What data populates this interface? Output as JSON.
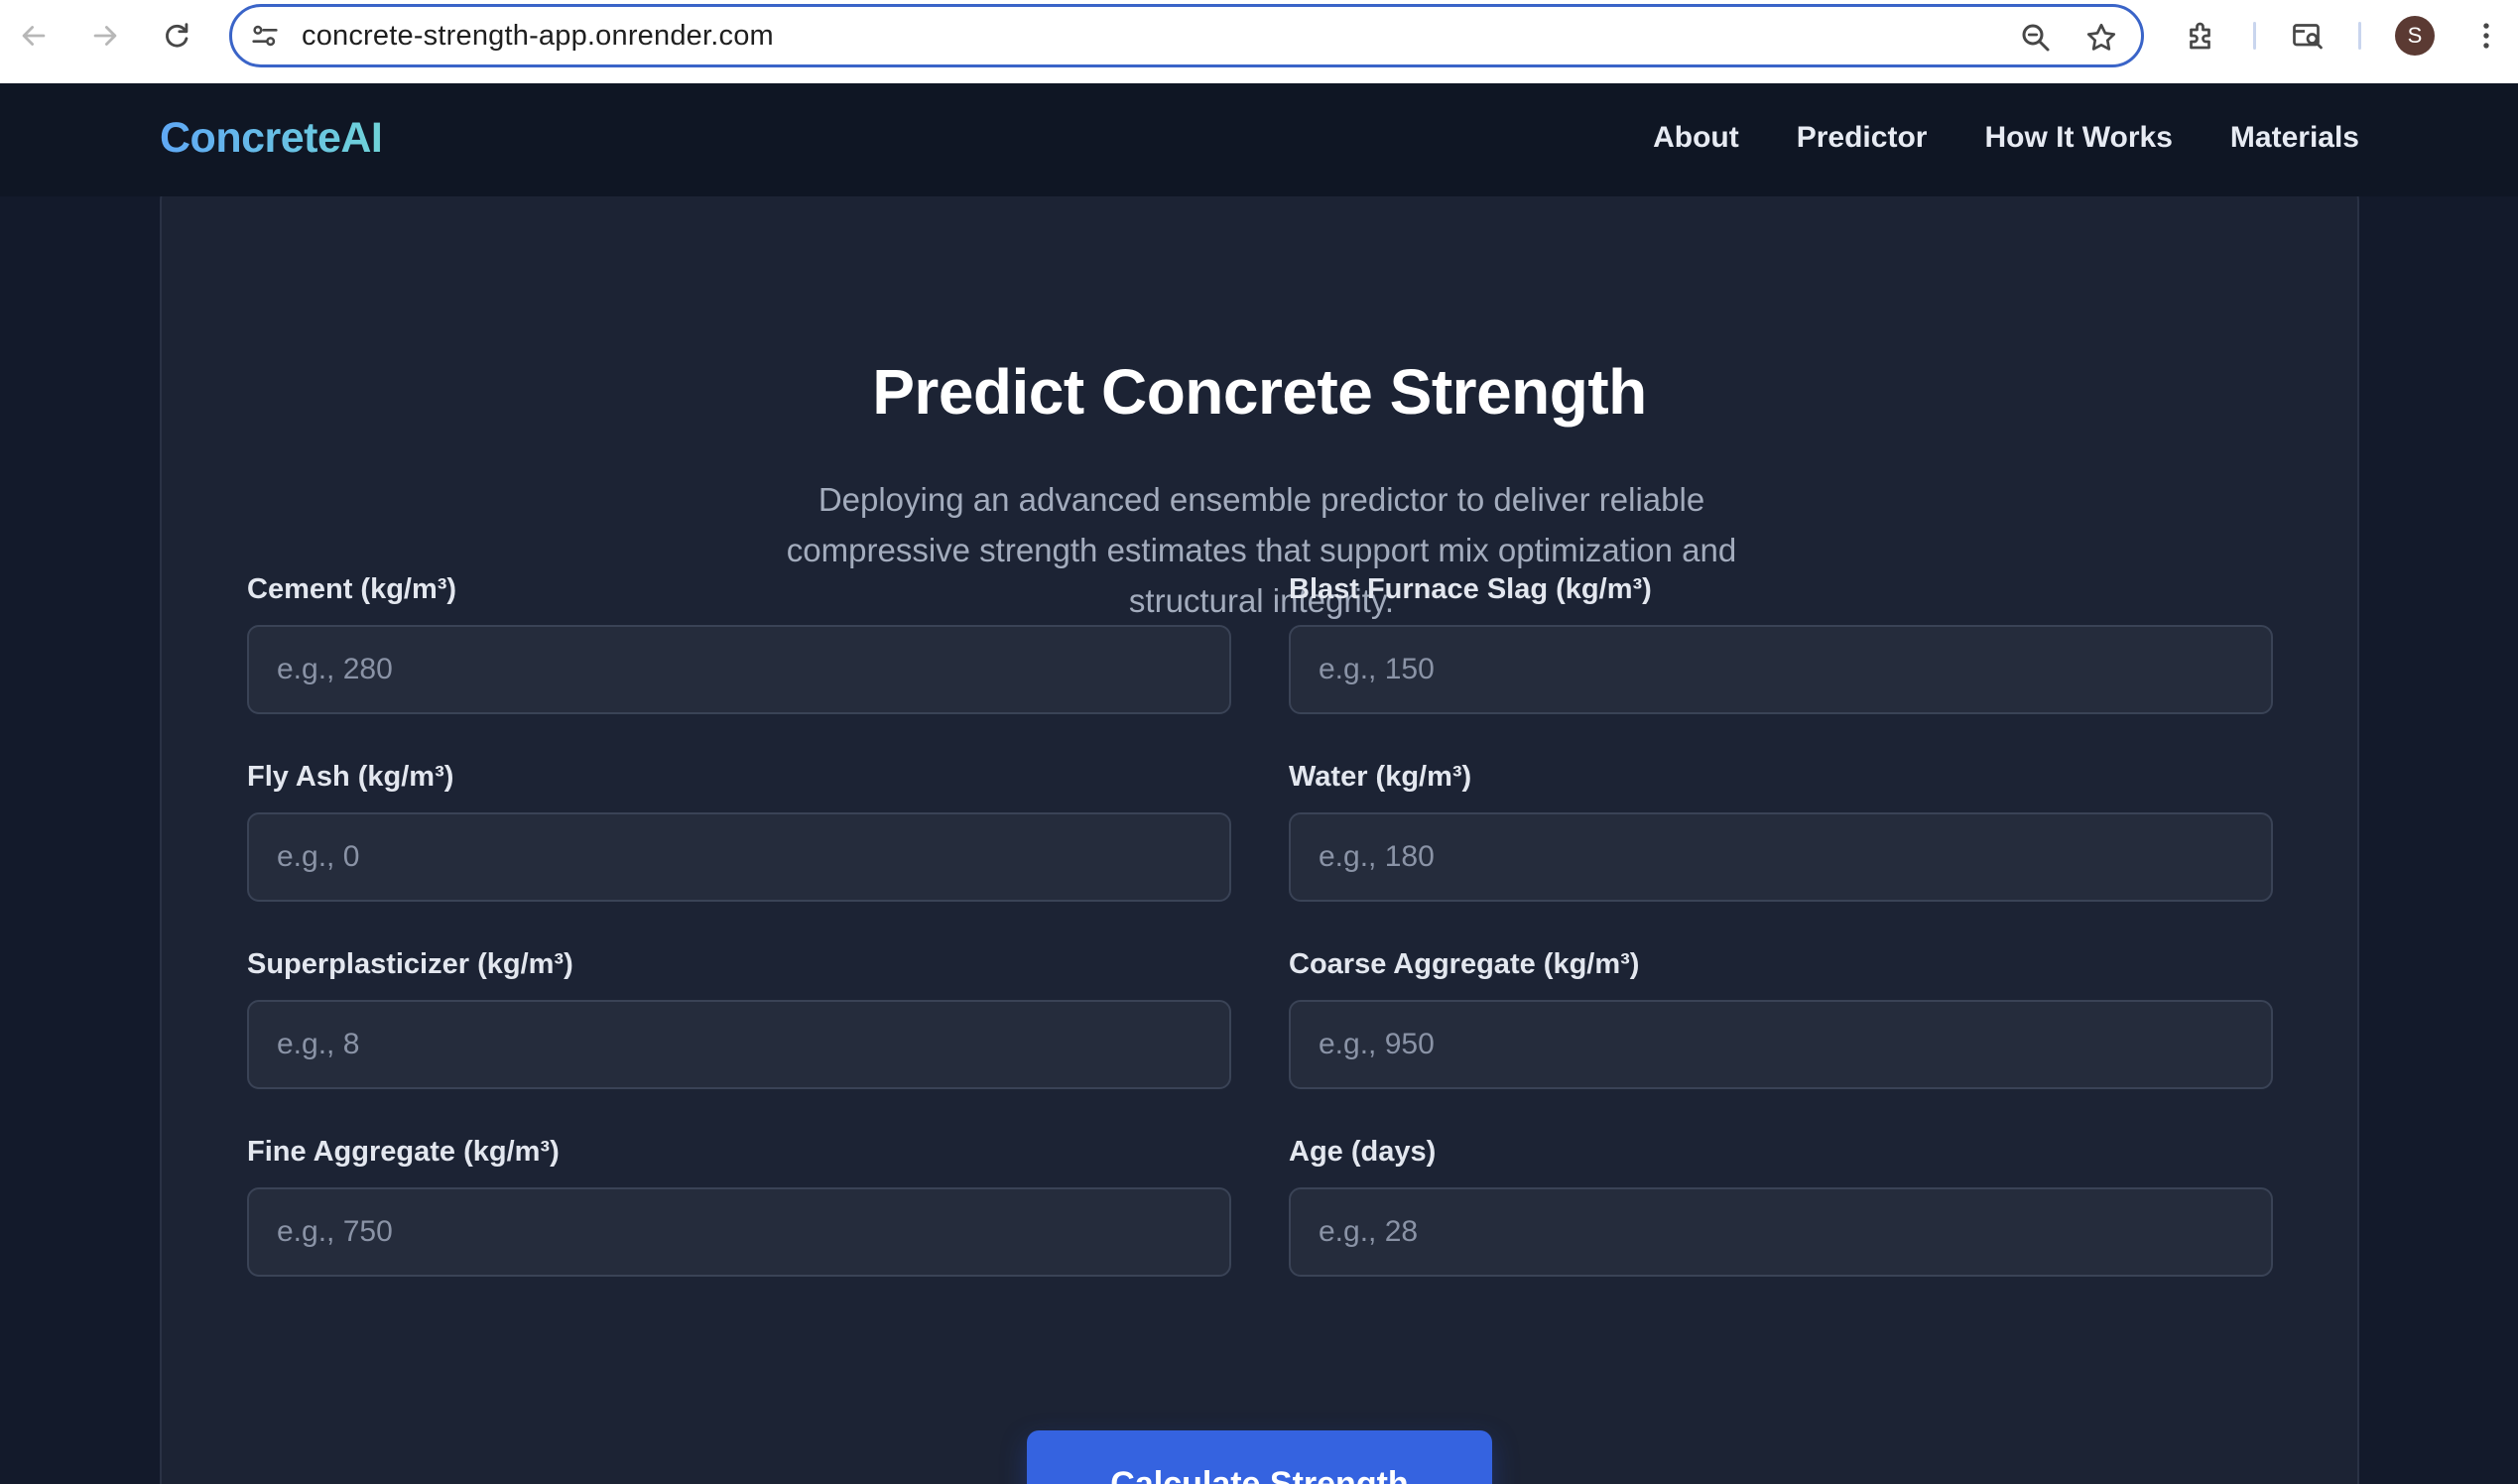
{
  "browser": {
    "url": "concrete-strength-app.onrender.com",
    "profile_initial": "S",
    "accent_color": "#3a64c8"
  },
  "site": {
    "brand": "ConcreteAI",
    "nav": [
      {
        "label": "About"
      },
      {
        "label": "Predictor"
      },
      {
        "label": "How It Works"
      },
      {
        "label": "Materials"
      }
    ]
  },
  "predictor": {
    "title": "Predict Concrete Strength",
    "subtitle": "Deploying an advanced ensemble predictor to deliver reliable compressive strength estimates that support mix optimization and structural integrity.",
    "fields": [
      {
        "label": "Cement (kg/m³)",
        "placeholder": "e.g., 280",
        "value": ""
      },
      {
        "label": "Blast Furnace Slag (kg/m³)",
        "placeholder": "e.g., 150",
        "value": ""
      },
      {
        "label": "Fly Ash (kg/m³)",
        "placeholder": "e.g., 0",
        "value": ""
      },
      {
        "label": "Water (kg/m³)",
        "placeholder": "e.g., 180",
        "value": ""
      },
      {
        "label": "Superplasticizer (kg/m³)",
        "placeholder": "e.g., 8",
        "value": ""
      },
      {
        "label": "Coarse Aggregate (kg/m³)",
        "placeholder": "e.g., 950",
        "value": ""
      },
      {
        "label": "Fine Aggregate (kg/m³)",
        "placeholder": "e.g., 750",
        "value": ""
      },
      {
        "label": "Age (days)",
        "placeholder": "e.g., 28",
        "value": ""
      }
    ],
    "submit_label": "Calculate Strength",
    "button_color": "#3563e0"
  },
  "icons": {
    "back": "arrow-left-icon",
    "forward": "arrow-right-icon",
    "reload": "reload-icon",
    "site_info": "tune-icon",
    "zoom": "zoom-icon",
    "bookmark": "star-icon",
    "extensions": "puzzle-icon",
    "tab_search": "tab-search-icon",
    "menu": "kebab-menu-icon"
  }
}
